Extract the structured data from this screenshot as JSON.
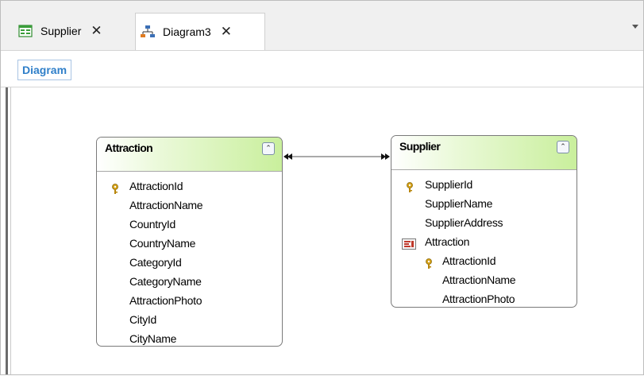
{
  "tabs": [
    {
      "label": "Supplier",
      "close": "✕",
      "icon": "transaction-icon"
    },
    {
      "label": "Diagram3",
      "close": "✕",
      "icon": "diagram-icon"
    }
  ],
  "toolbar": {
    "diagram_label": "Diagram"
  },
  "tables": {
    "attraction": {
      "title": "Attraction",
      "collapse": "⌃",
      "rows": [
        "AttractionId",
        "AttractionName",
        "CountryId",
        "CountryName",
        "CategoryId",
        "CategoryName",
        "AttractionPhoto",
        "CityId",
        "CityName"
      ]
    },
    "supplier": {
      "title": "Supplier",
      "collapse": "⌃",
      "rows": [
        "SupplierId",
        "SupplierName",
        "SupplierAddress",
        "Attraction",
        "AttractionId",
        "AttractionName",
        "AttractionPhoto"
      ]
    }
  },
  "colors": {
    "header_green": "#c9ef9c",
    "accent_blue": "#2f7fc9",
    "key_gold": "#d4a017"
  }
}
